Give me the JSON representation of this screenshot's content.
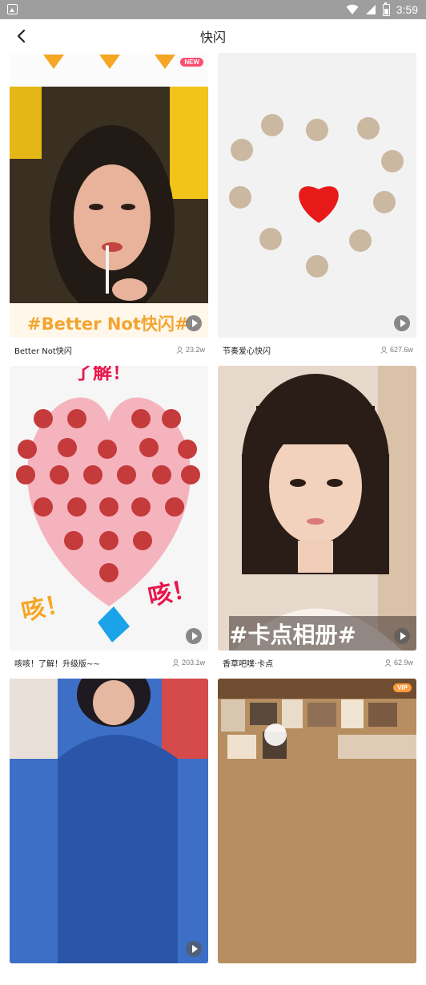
{
  "status_bar": {
    "time": "3:59",
    "icons": [
      "app-notification-icon",
      "wifi-icon",
      "signal-icon",
      "battery-icon"
    ]
  },
  "header": {
    "title": "快闪",
    "back_icon": "chevron-left-icon"
  },
  "colors": {
    "new_badge": "#ff4d6d",
    "vip_badge": "#ff9a3c",
    "title_text": "#222222",
    "meta_text": "#777777"
  },
  "cards": [
    {
      "title": "Better Not快闪",
      "views": "23.2w",
      "badge": "NEW",
      "overlay": "#Better Not快闪#"
    },
    {
      "title": "节奏爱心快闪",
      "views": "627.6w"
    },
    {
      "title": "咳咳！了解！升级版~~",
      "views": "203.1w",
      "overlay_top": "了解！",
      "overlay_left": "咳！",
      "overlay_right": "咳！"
    },
    {
      "title": "香草吧噗·卡点",
      "views": "62.9w",
      "overlay": "#卡点相册#"
    },
    {
      "title": "",
      "views": ""
    },
    {
      "title": "",
      "views": "",
      "badge": "VIP"
    }
  ]
}
